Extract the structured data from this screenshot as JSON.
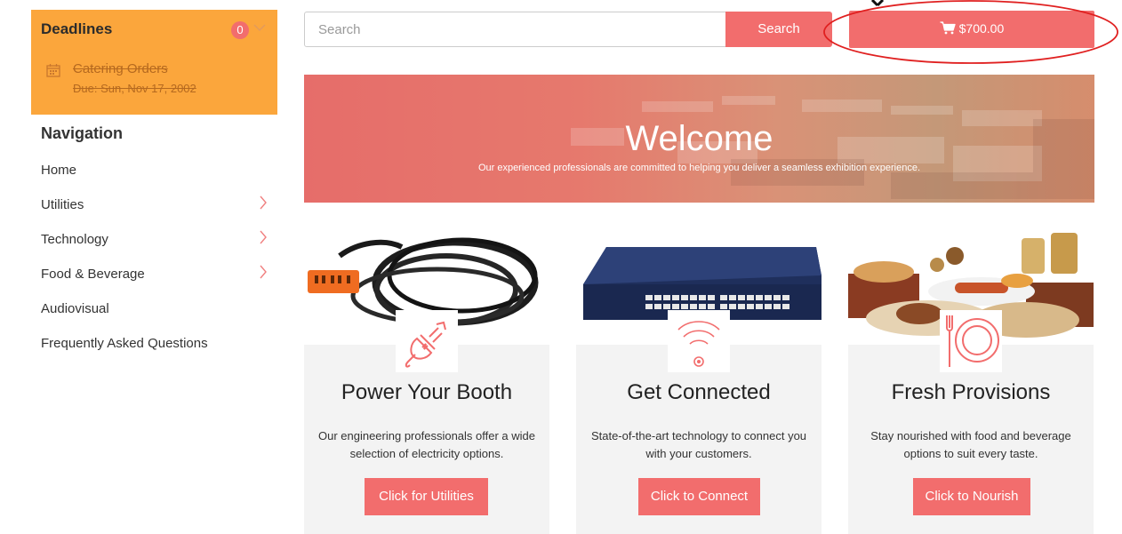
{
  "deadlines": {
    "title": "Deadlines",
    "count": "0",
    "items": [
      {
        "title": "Catering Orders",
        "due": "Due: Sun, Nov 17, 2002"
      }
    ]
  },
  "navigation": {
    "heading": "Navigation",
    "items": [
      {
        "label": "Home",
        "has_submenu": false
      },
      {
        "label": "Utilities",
        "has_submenu": true
      },
      {
        "label": "Technology",
        "has_submenu": true
      },
      {
        "label": "Food & Beverage",
        "has_submenu": true
      },
      {
        "label": "Audiovisual",
        "has_submenu": false
      },
      {
        "label": "Frequently Asked Questions",
        "has_submenu": false
      }
    ]
  },
  "search": {
    "placeholder": "Search",
    "button_label": "Search"
  },
  "cart": {
    "total": "$700.00",
    "icon": "shopping-cart-icon"
  },
  "banner": {
    "title": "Welcome",
    "subtitle": "Our experienced professionals are committed to helping you deliver a seamless exhibition experience."
  },
  "cards": [
    {
      "title": "Power Your Booth",
      "description": "Our engineering professionals offer a wide selection of electricity options.",
      "button": "Click for Utilities",
      "icon": "power-plug-icon",
      "photo": "extension-cord-photo"
    },
    {
      "title": "Get Connected",
      "description": "State-of-the-art technology to connect you with your customers.",
      "button": "Click to Connect",
      "icon": "wifi-icon",
      "photo": "network-switch-photo"
    },
    {
      "title": "Fresh Provisions",
      "description": "Stay nourished with food and beverage options to suit every taste.",
      "button": "Click to Nourish",
      "icon": "plate-cutlery-icon",
      "photo": "catering-food-photo"
    }
  ],
  "colors": {
    "accent": "#f26d6d",
    "deadline_panel": "#fba63c",
    "annotation": "#e02020"
  }
}
